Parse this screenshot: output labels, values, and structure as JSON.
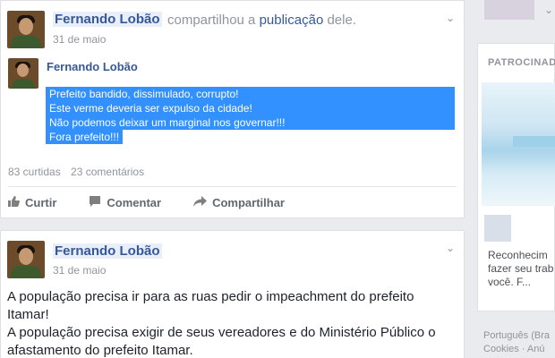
{
  "post1": {
    "author": "Fernando Lobão",
    "shared_text_pre": "compartilhou a ",
    "shared_link": "publicação",
    "shared_text_post": " dele.",
    "date": "31 de maio",
    "inner": {
      "author": "Fernando Lobão",
      "lines": [
        "Prefeito bandido, dissimulado, corrupto!",
        "Este verme deveria ser expulso da cidade!",
        "Não podemos deixar um marginal nos governar!!!",
        "Fora prefeito!!!"
      ]
    },
    "likes": "83 curtidas",
    "comments": "23 comentários",
    "actions": {
      "like": "Curtir",
      "comment": "Comentar",
      "share": "Compartilhar"
    }
  },
  "post2": {
    "author": "Fernando Lobão",
    "date": "31 de maio",
    "text_lines": [
      "A população precisa ir para as ruas pedir o impeachment do prefeito",
      "Itamar!",
      "A população precisa exigir de seus vereadores e do Ministério Público o",
      "afastamento do prefeito Itamar."
    ]
  },
  "sidebar": {
    "sponsored_label": "PATROCINAD",
    "ad_text": [
      "Reconhecim",
      "fazer seu trab",
      "você. F..."
    ],
    "footer": [
      "Português (Bra",
      "Cookies · Anú"
    ]
  },
  "icons": {
    "like": "thumbs-up-icon",
    "comment": "comment-icon",
    "share": "share-arrow-icon",
    "menu": "chevron-down-icon"
  },
  "colors": {
    "link": "#365899",
    "highlight": "#3390ff",
    "muted": "#90949c"
  }
}
